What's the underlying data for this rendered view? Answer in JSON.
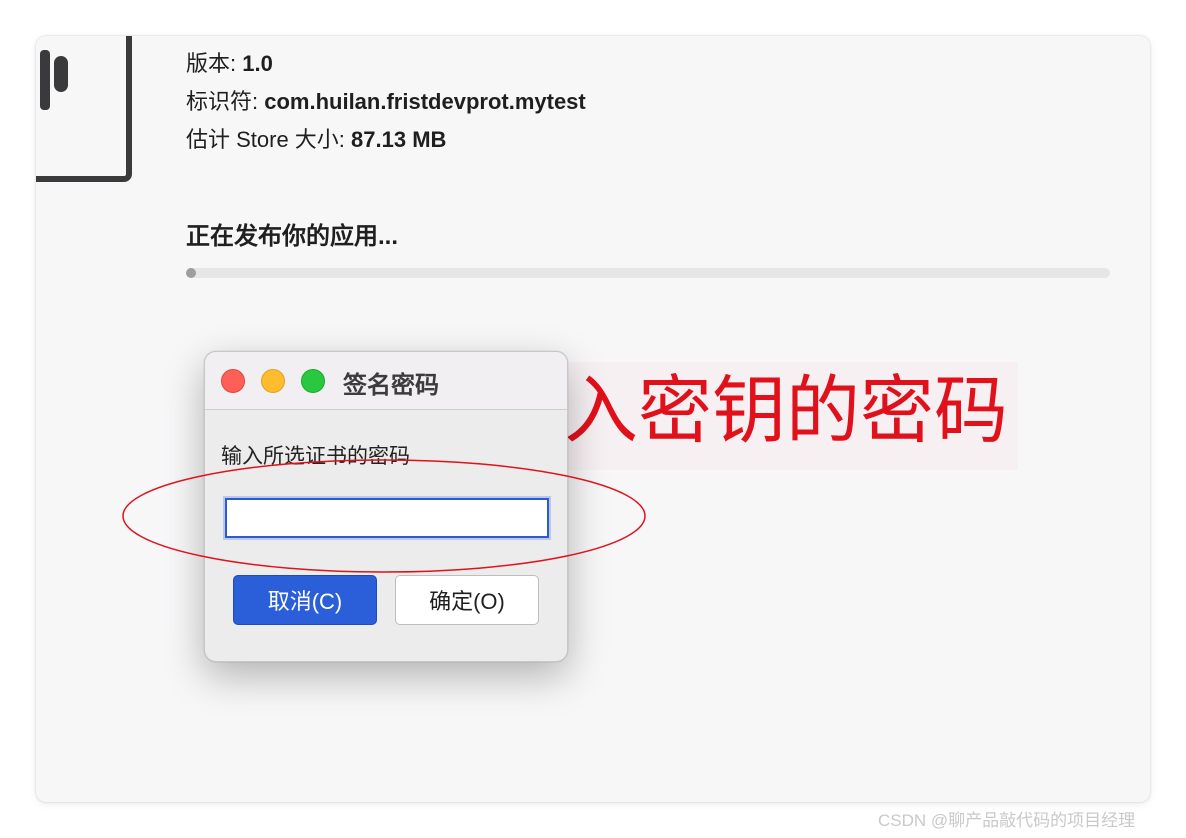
{
  "window": {
    "version_label": "版本: ",
    "version_value": "1.0",
    "identifier_label": "标识符: ",
    "identifier_value": "com.huilan.fristdevprot.mytest",
    "size_label": "估计 Store 大小: ",
    "size_value": "87.13 MB",
    "status_text": "正在发布你的应用...",
    "progress": 0.01
  },
  "dialog": {
    "title": "签名密码",
    "prompt": "输入所选证书的密码",
    "password_value": "",
    "cancel_label": "取消(C)",
    "ok_label": "确定(O)"
  },
  "annotation": {
    "text": "输入密钥的密码",
    "color": "#e0111b"
  },
  "watermark": "CSDN @聊产品敲代码的项目经理",
  "colors": {
    "accent": "#2b5fd9",
    "annotation": "#e0111b"
  }
}
